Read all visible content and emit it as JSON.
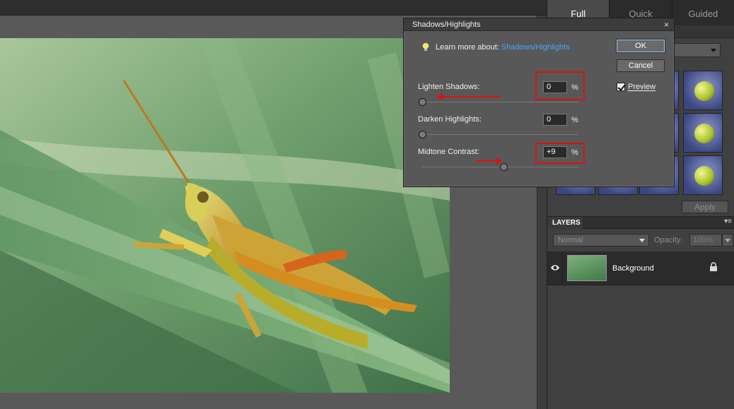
{
  "mode_tabs": [
    "Full",
    "Quick",
    "Guided"
  ],
  "active_mode": "Full",
  "effects": {
    "apply_label": "Apply"
  },
  "layers": {
    "tab_label": "LAYERS",
    "blend_mode": "Normal",
    "opacity_label": "Opacity:",
    "opacity_value": "100%",
    "layer_name": "Background"
  },
  "dialog": {
    "title": "Shadows/Highlights",
    "close": "×",
    "learn_prefix": "Learn more about:",
    "learn_link": "Shadows/Highlights",
    "ok_label": "OK",
    "cancel_label": "Cancel",
    "preview_label": "Preview",
    "preview_checked": true,
    "sliders": [
      {
        "label": "Lighten Shadows:",
        "value": "0",
        "unit": "%",
        "level": 0.0
      },
      {
        "label": "Darken Highlights:",
        "value": "0",
        "unit": "%",
        "level": 0.0
      },
      {
        "label": "Midtone Contrast:",
        "value": "+9",
        "unit": "%",
        "level": 0.545
      }
    ]
  },
  "colors": {
    "highlight": "#e01010",
    "link": "#4ea3ff",
    "panel": "#404040",
    "dialog": "#585858"
  }
}
